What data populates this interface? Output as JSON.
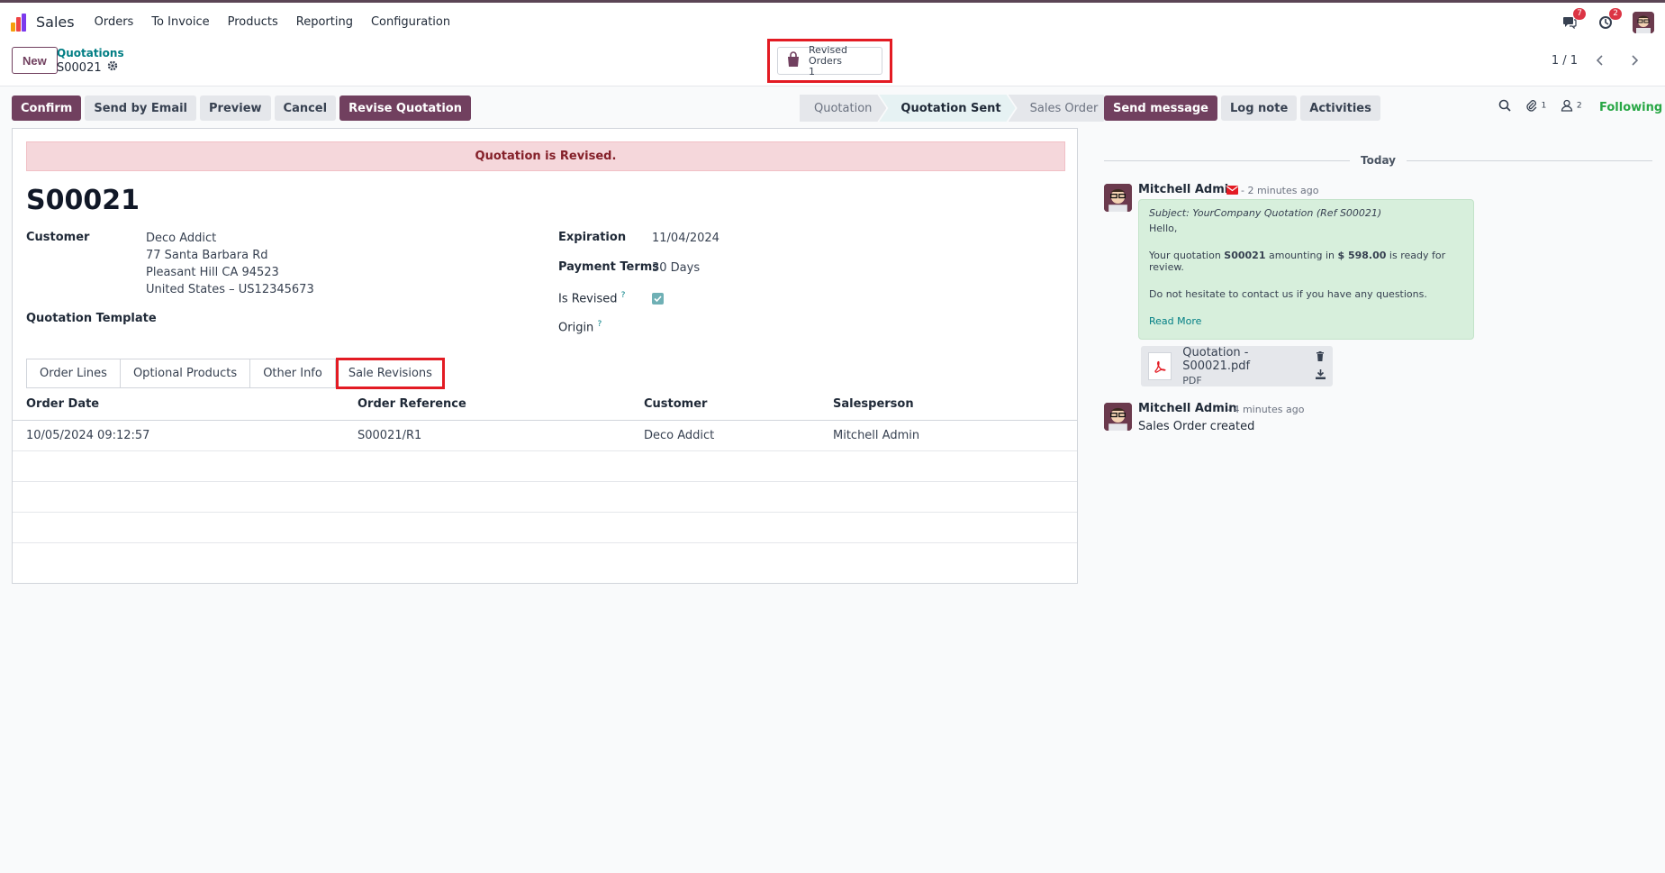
{
  "topbar": {
    "app_name": "Sales",
    "menu": [
      "Orders",
      "To Invoice",
      "Products",
      "Reporting",
      "Configuration"
    ],
    "messages_badge": "7",
    "activities_badge": "2"
  },
  "control": {
    "new_label": "New",
    "breadcrumb_parent": "Quotations",
    "breadcrumb_current": "S00021",
    "smart_button_label": "Revised Orders",
    "smart_button_count": "1",
    "pager": "1 / 1"
  },
  "actions": {
    "confirm": "Confirm",
    "send_email": "Send by Email",
    "preview": "Preview",
    "cancel": "Cancel",
    "revise": "Revise Quotation"
  },
  "statusbar": [
    "Quotation",
    "Quotation Sent",
    "Sales Order"
  ],
  "form": {
    "alert": "Quotation is Revised.",
    "name": "S00021",
    "customer_label": "Customer",
    "customer_name": "Deco Addict",
    "customer_addr1": "77 Santa Barbara Rd",
    "customer_addr2": "Pleasant Hill CA 94523",
    "customer_addr3": "United States – US12345673",
    "template_label": "Quotation Template",
    "expiration_label": "Expiration",
    "expiration_value": "11/04/2024",
    "payment_label": "Payment Terms",
    "payment_value": "30 Days",
    "revised_label": "Is Revised",
    "origin_label": "Origin",
    "help_mark": "?"
  },
  "tabs": [
    "Order Lines",
    "Optional Products",
    "Other Info",
    "Sale Revisions"
  ],
  "revisions": {
    "headers": [
      "Order Date",
      "Order Reference",
      "Customer",
      "Salesperson"
    ],
    "rows": [
      [
        "10/05/2024 09:12:57",
        "S00021/R1",
        "Deco Addict",
        "Mitchell Admin"
      ]
    ]
  },
  "chatter": {
    "send_message": "Send message",
    "log_note": "Log note",
    "activities": "Activities",
    "attachments_count": "1",
    "followers_count": "2",
    "following": "Following",
    "today": "Today",
    "msg1": {
      "author": "Mitchell Admin",
      "ago": "- 2 minutes ago",
      "subject": "Subject: YourCompany Quotation (Ref S00021)",
      "hello": "Hello,",
      "body_pre": "Your quotation ",
      "body_ref": "S00021",
      "body_mid": " amounting in ",
      "body_amount": "$ 598.00",
      "body_post": " is ready for review.",
      "body2": "Do not hesitate to contact us if you have any questions.",
      "read_more": "Read More",
      "attachment_name": "Quotation - S00021.pdf",
      "attachment_type": "PDF"
    },
    "msg2": {
      "author": "Mitchell Admin",
      "ago": "- 4 minutes ago",
      "body": "Sales Order created"
    }
  }
}
